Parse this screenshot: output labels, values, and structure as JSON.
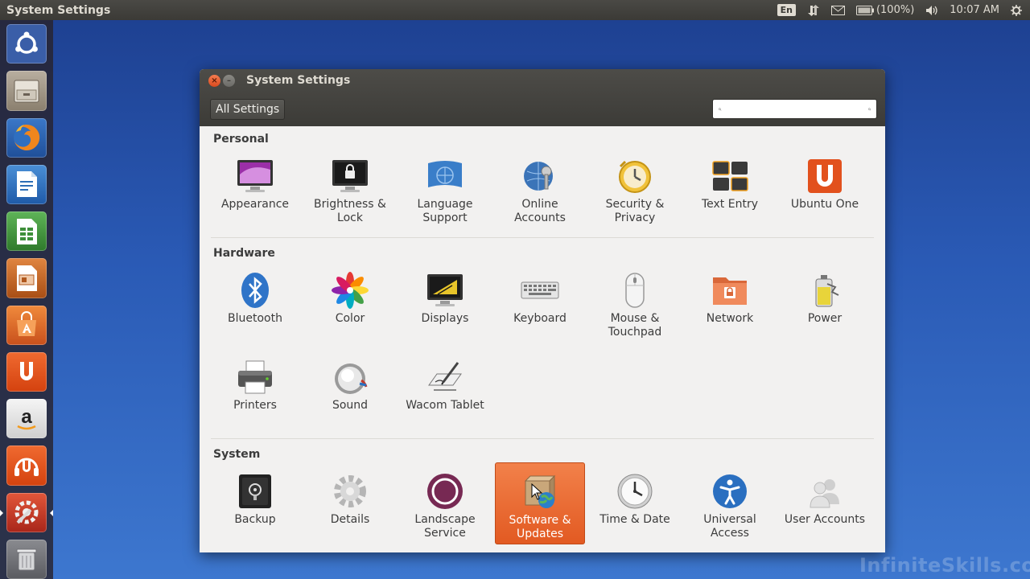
{
  "panel": {
    "title": "System Settings",
    "keyboard_layout": "En",
    "battery": "(100%)",
    "clock": "10:07 AM"
  },
  "launcher": {
    "items": [
      {
        "name": "dash-home",
        "color": "#3a5ea8"
      },
      {
        "name": "files",
        "color": "#8a7f6e"
      },
      {
        "name": "firefox",
        "color": "#2a63b8"
      },
      {
        "name": "writer",
        "color": "#2d6eb5"
      },
      {
        "name": "calc",
        "color": "#3e8f3a"
      },
      {
        "name": "impress",
        "color": "#b0581e"
      },
      {
        "name": "software-center",
        "color": "#d85b25"
      },
      {
        "name": "ubuntu-one",
        "color": "#e2511d"
      },
      {
        "name": "amazon",
        "color": "#7b6f62"
      },
      {
        "name": "ubuntu-one-music",
        "color": "#e2511d"
      },
      {
        "name": "system-settings",
        "color": "#c1391f"
      },
      {
        "name": "trash",
        "color": "#6f7075"
      }
    ]
  },
  "window": {
    "title": "System Settings",
    "all_settings_label": "All Settings",
    "search_value": ""
  },
  "sections": {
    "personal": {
      "title": "Personal",
      "items": [
        "Appearance",
        "Brightness &\nLock",
        "Language\nSupport",
        "Online\nAccounts",
        "Security &\nPrivacy",
        "Text Entry",
        "Ubuntu One"
      ]
    },
    "hardware": {
      "title": "Hardware",
      "items": [
        "Bluetooth",
        "Color",
        "Displays",
        "Keyboard",
        "Mouse &\nTouchpad",
        "Network",
        "Power",
        "Printers",
        "Sound",
        "Wacom Tablet"
      ]
    },
    "system": {
      "title": "System",
      "items": [
        "Backup",
        "Details",
        "Landscape\nService",
        "Software &\nUpdates",
        "Time & Date",
        "Universal\nAccess",
        "User Accounts"
      ]
    }
  },
  "watermark": "InfiniteSkills.com"
}
